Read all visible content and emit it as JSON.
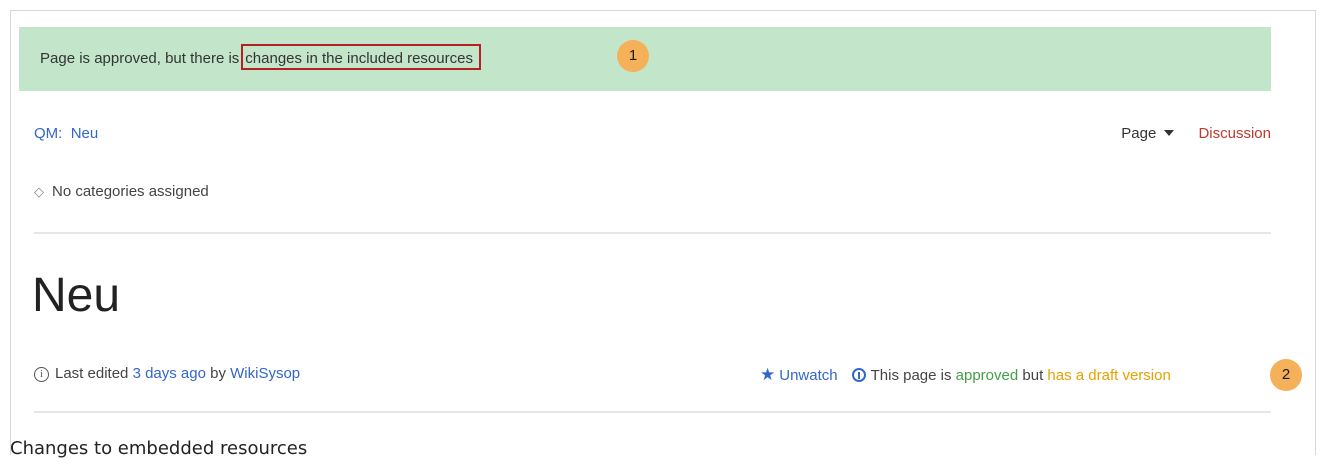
{
  "banner": {
    "text_prefix": "Page is approved, but there is",
    "highlight": "changes in the included resources",
    "badge": "1"
  },
  "breadcrumb": {
    "namespace": "QM:",
    "page": "Neu"
  },
  "actions": {
    "page_menu": "Page",
    "discussion": "Discussion"
  },
  "categories": {
    "text": "No categories assigned"
  },
  "page": {
    "title": "Neu"
  },
  "meta": {
    "prefix": "Last edited",
    "time": "3 days ago",
    "by": "by",
    "user": "WikiSysop"
  },
  "status": {
    "unwatch": "Unwatch",
    "prefix": "This page is",
    "approved": "approved",
    "middle": "but",
    "draft": "has a draft version",
    "badge": "2"
  },
  "caption": "Changes to embedded resources",
  "colors": {
    "banner_bg": "#c3e6cb",
    "highlight_border": "#b22222",
    "badge": "#f5b05a",
    "link": "#3366cc",
    "approved": "#43a047",
    "draft": "#e5a100",
    "discussion": "#c0392b"
  }
}
